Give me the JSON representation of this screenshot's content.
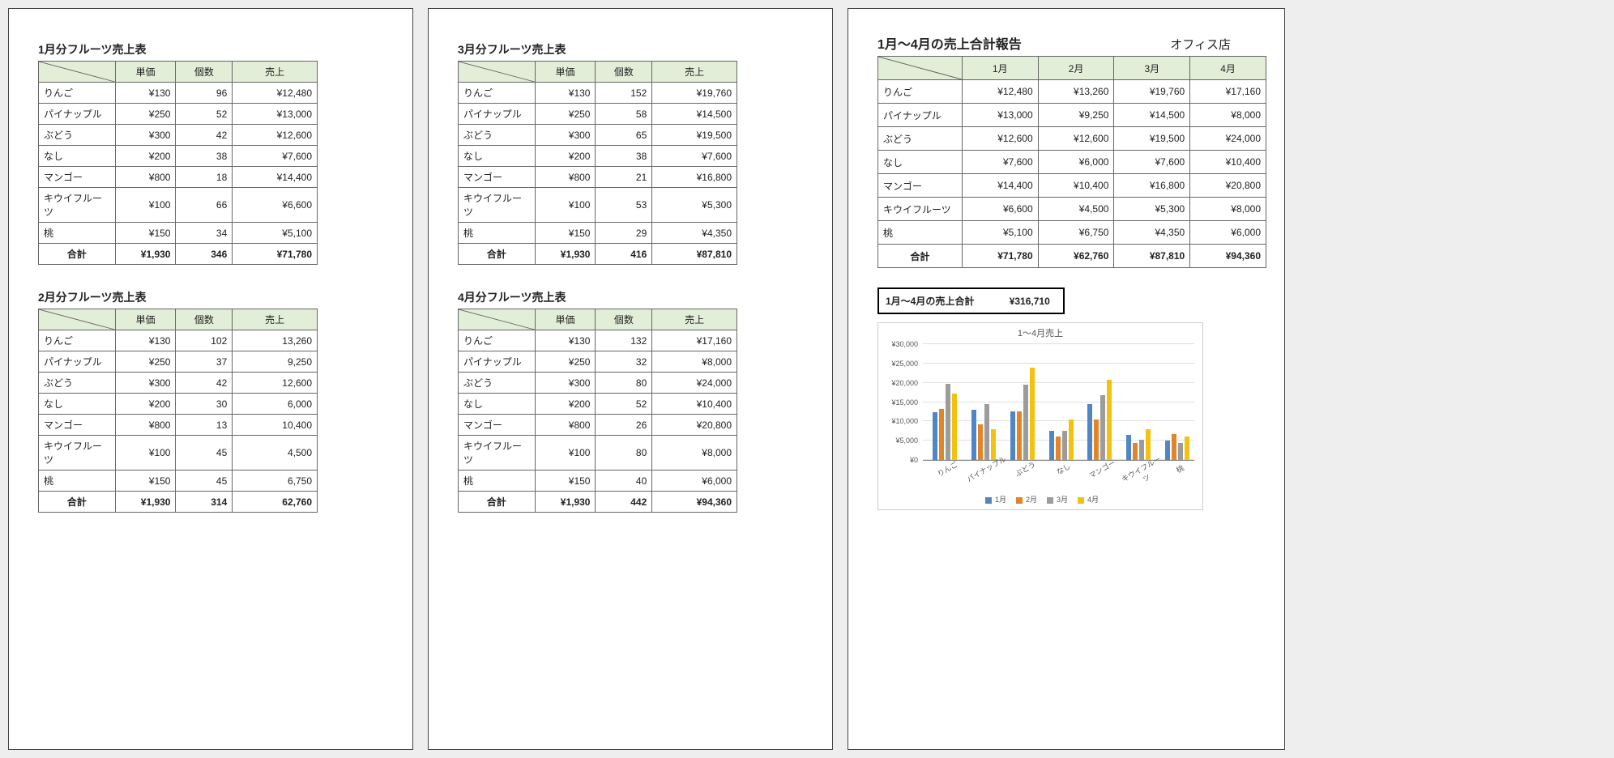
{
  "months": [
    {
      "title": "1月分フルーツ売上表",
      "headers": [
        "単価",
        "個数",
        "売上"
      ],
      "rows": [
        {
          "name": "りんご",
          "price": "¥130",
          "qty": "96",
          "amt": "¥12,480"
        },
        {
          "name": "パイナップル",
          "price": "¥250",
          "qty": "52",
          "amt": "¥13,000"
        },
        {
          "name": "ぶどう",
          "price": "¥300",
          "qty": "42",
          "amt": "¥12,600"
        },
        {
          "name": "なし",
          "price": "¥200",
          "qty": "38",
          "amt": "¥7,600"
        },
        {
          "name": "マンゴー",
          "price": "¥800",
          "qty": "18",
          "amt": "¥14,400"
        },
        {
          "name": "キウイフルーツ",
          "price": "¥100",
          "qty": "66",
          "amt": "¥6,600"
        },
        {
          "name": "桃",
          "price": "¥150",
          "qty": "34",
          "amt": "¥5,100"
        }
      ],
      "total": {
        "label": "合計",
        "price": "¥1,930",
        "qty": "346",
        "amt": "¥71,780"
      }
    },
    {
      "title": "2月分フルーツ売上表",
      "headers": [
        "単価",
        "個数",
        "売上"
      ],
      "rows": [
        {
          "name": "りんご",
          "price": "¥130",
          "qty": "102",
          "amt": "13,260"
        },
        {
          "name": "パイナップル",
          "price": "¥250",
          "qty": "37",
          "amt": "9,250"
        },
        {
          "name": "ぶどう",
          "price": "¥300",
          "qty": "42",
          "amt": "12,600"
        },
        {
          "name": "なし",
          "price": "¥200",
          "qty": "30",
          "amt": "6,000"
        },
        {
          "name": "マンゴー",
          "price": "¥800",
          "qty": "13",
          "amt": "10,400"
        },
        {
          "name": "キウイフルーツ",
          "price": "¥100",
          "qty": "45",
          "amt": "4,500"
        },
        {
          "name": "桃",
          "price": "¥150",
          "qty": "45",
          "amt": "6,750"
        }
      ],
      "total": {
        "label": "合計",
        "price": "¥1,930",
        "qty": "314",
        "amt": "62,760"
      }
    },
    {
      "title": "3月分フルーツ売上表",
      "headers": [
        "単価",
        "個数",
        "売上"
      ],
      "rows": [
        {
          "name": "りんご",
          "price": "¥130",
          "qty": "152",
          "amt": "¥19,760"
        },
        {
          "name": "パイナップル",
          "price": "¥250",
          "qty": "58",
          "amt": "¥14,500"
        },
        {
          "name": "ぶどう",
          "price": "¥300",
          "qty": "65",
          "amt": "¥19,500"
        },
        {
          "name": "なし",
          "price": "¥200",
          "qty": "38",
          "amt": "¥7,600"
        },
        {
          "name": "マンゴー",
          "price": "¥800",
          "qty": "21",
          "amt": "¥16,800"
        },
        {
          "name": "キウイフルーツ",
          "price": "¥100",
          "qty": "53",
          "amt": "¥5,300"
        },
        {
          "name": "桃",
          "price": "¥150",
          "qty": "29",
          "amt": "¥4,350"
        }
      ],
      "total": {
        "label": "合計",
        "price": "¥1,930",
        "qty": "416",
        "amt": "¥87,810"
      }
    },
    {
      "title": "4月分フルーツ売上表",
      "headers": [
        "単価",
        "個数",
        "売上"
      ],
      "rows": [
        {
          "name": "りんご",
          "price": "¥130",
          "qty": "132",
          "amt": "¥17,160"
        },
        {
          "name": "パイナップル",
          "price": "¥250",
          "qty": "32",
          "amt": "¥8,000"
        },
        {
          "name": "ぶどう",
          "price": "¥300",
          "qty": "80",
          "amt": "¥24,000"
        },
        {
          "name": "なし",
          "price": "¥200",
          "qty": "52",
          "amt": "¥10,400"
        },
        {
          "name": "マンゴー",
          "price": "¥800",
          "qty": "26",
          "amt": "¥20,800"
        },
        {
          "name": "キウイフルーツ",
          "price": "¥100",
          "qty": "80",
          "amt": "¥8,000"
        },
        {
          "name": "桃",
          "price": "¥150",
          "qty": "40",
          "amt": "¥6,000"
        }
      ],
      "total": {
        "label": "合計",
        "price": "¥1,930",
        "qty": "442",
        "amt": "¥94,360"
      }
    }
  ],
  "summary": {
    "title": "1月～4月の売上合計報告",
    "store": "オフィス店",
    "headers": [
      "1月",
      "2月",
      "3月",
      "4月"
    ],
    "rows": [
      {
        "name": "りんご",
        "v": [
          "¥12,480",
          "¥13,260",
          "¥19,760",
          "¥17,160"
        ]
      },
      {
        "name": "パイナップル",
        "v": [
          "¥13,000",
          "¥9,250",
          "¥14,500",
          "¥8,000"
        ]
      },
      {
        "name": "ぶどう",
        "v": [
          "¥12,600",
          "¥12,600",
          "¥19,500",
          "¥24,000"
        ]
      },
      {
        "name": "なし",
        "v": [
          "¥7,600",
          "¥6,000",
          "¥7,600",
          "¥10,400"
        ]
      },
      {
        "name": "マンゴー",
        "v": [
          "¥14,400",
          "¥10,400",
          "¥16,800",
          "¥20,800"
        ]
      },
      {
        "name": "キウイフルーツ",
        "v": [
          "¥6,600",
          "¥4,500",
          "¥5,300",
          "¥8,000"
        ]
      },
      {
        "name": "桃",
        "v": [
          "¥5,100",
          "¥6,750",
          "¥4,350",
          "¥6,000"
        ]
      }
    ],
    "total": {
      "label": "合計",
      "v": [
        "¥71,780",
        "¥62,760",
        "¥87,810",
        "¥94,360"
      ]
    },
    "grand_label": "1月～4月の売上合計",
    "grand_value": "¥316,710"
  },
  "chart_data": {
    "type": "bar",
    "title": "1～4月売上",
    "categories": [
      "りんご",
      "パイナップル",
      "ぶどう",
      "なし",
      "マンゴー",
      "キウイフルーツ",
      "桃"
    ],
    "series": [
      {
        "name": "1月",
        "values": [
          12480,
          13000,
          12600,
          7600,
          14400,
          6600,
          5100
        ]
      },
      {
        "name": "2月",
        "values": [
          13260,
          9250,
          12600,
          6000,
          10400,
          4500,
          6750
        ]
      },
      {
        "name": "3月",
        "values": [
          19760,
          14500,
          19500,
          7600,
          16800,
          5300,
          4350
        ]
      },
      {
        "name": "4月",
        "values": [
          17160,
          8000,
          24000,
          10400,
          20800,
          8000,
          6000
        ]
      }
    ],
    "ylabel": "",
    "ylim": [
      0,
      30000
    ],
    "yticks": [
      "¥0",
      "¥5,000",
      "¥10,000",
      "¥15,000",
      "¥20,000",
      "¥25,000",
      "¥30,000"
    ],
    "colors": [
      "#4f87c6",
      "#e38429",
      "#9c9c9c",
      "#f2c20f"
    ]
  }
}
